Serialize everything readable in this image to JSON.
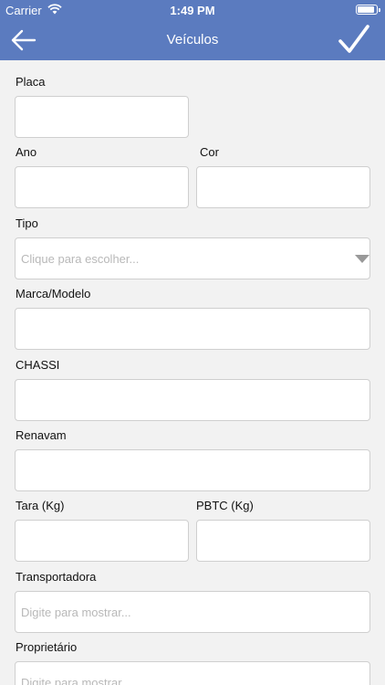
{
  "status_bar": {
    "carrier": "Carrier",
    "time": "1:49 PM",
    "battery_level": 0.95
  },
  "nav": {
    "title": "Veículos",
    "back_icon": "arrow-left-icon",
    "confirm_icon": "checkmark-icon"
  },
  "form": {
    "placa": {
      "label": "Placa",
      "value": ""
    },
    "ano": {
      "label": "Ano",
      "value": ""
    },
    "cor": {
      "label": "Cor",
      "value": ""
    },
    "tipo": {
      "label": "Tipo",
      "placeholder": "Clique para escolher..."
    },
    "marca_modelo": {
      "label": "Marca/Modelo",
      "value": ""
    },
    "chassi": {
      "label": "CHASSI",
      "value": ""
    },
    "renavam": {
      "label": "Renavam",
      "value": ""
    },
    "tara": {
      "label": "Tara (Kg)",
      "value": ""
    },
    "pbtc": {
      "label": "PBTC (Kg)",
      "value": ""
    },
    "transportadora": {
      "label": "Transportadora",
      "placeholder": "Digite para mostrar..."
    },
    "proprietario": {
      "label": "Proprietário",
      "placeholder": "Digite para mostrar..."
    }
  }
}
